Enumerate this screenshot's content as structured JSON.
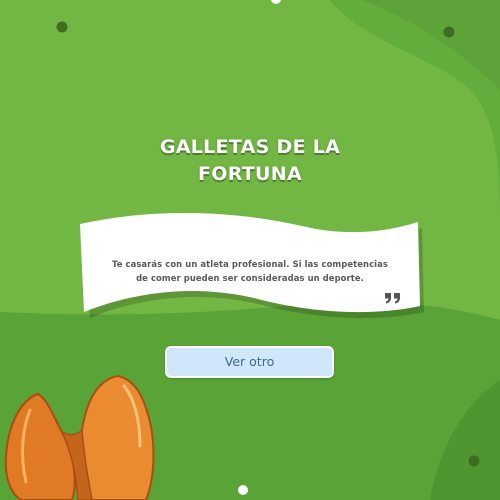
{
  "app": {
    "title_line1": "GALLETAS DE LA",
    "title_line2": "FORTUNA"
  },
  "fortune": {
    "line1": "Te casarás con un atleta profesional. Si las competencias",
    "line2": "de comer pueden ser consideradas un deporte.",
    "quote_icon": "closing-quote-icon"
  },
  "actions": {
    "ver_otro_label": "Ver otro"
  },
  "decor": {
    "cookie_icon": "fortune-cookie-icon"
  },
  "colors": {
    "background": "#63ad3c",
    "background_light": "#72b744",
    "background_dark": "#4f9530",
    "paper": "#ffffff",
    "button_fill": "#cfe6fb",
    "button_text": "#3f6c8c",
    "cookie": "#e8832c"
  }
}
